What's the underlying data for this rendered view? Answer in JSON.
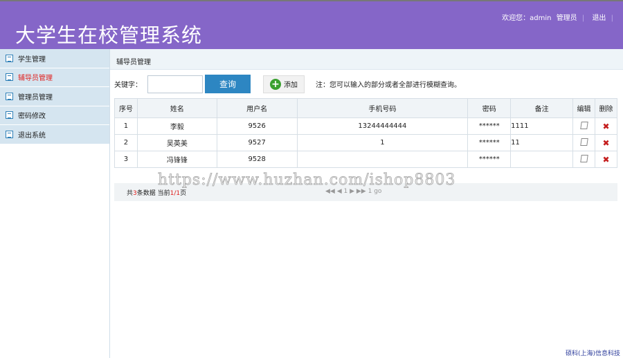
{
  "header": {
    "title": "大学生在校管理系统",
    "welcome": "欢迎您：admin",
    "role": "管理员",
    "logout": "退出"
  },
  "sidebar": {
    "items": [
      {
        "label": "学生管理"
      },
      {
        "label": "辅导员管理"
      },
      {
        "label": "管理员管理"
      },
      {
        "label": "密码修改"
      },
      {
        "label": "退出系统"
      }
    ]
  },
  "main": {
    "breadcrumb": "辅导员管理",
    "keyword_label": "关键字：",
    "keyword_value": "",
    "search_label": "查询",
    "add_label": "添加",
    "note": "注：您可以输入的部分或者全部进行模糊查询。",
    "columns": [
      "序号",
      "姓名",
      "用户名",
      "手机号码",
      "密码",
      "备注",
      "编辑",
      "删除"
    ],
    "rows": [
      {
        "no": "1",
        "name": "李毅",
        "username": "9526",
        "phone": "13244444444",
        "password": "******",
        "remark": "1111"
      },
      {
        "no": "2",
        "name": "吴英美",
        "username": "9527",
        "phone": "1",
        "password": "******",
        "remark": "11"
      },
      {
        "no": "3",
        "name": "冯锋锋",
        "username": "9528",
        "phone": "",
        "password": "******",
        "remark": ""
      }
    ],
    "pager": {
      "pre": "共",
      "count": "3",
      "mid": "条数据 当前",
      "page": "1/1",
      "post": "页",
      "nav": "◀◀ ◀ 1 ▶ ▶▶",
      "current": "1",
      "go": "go"
    }
  },
  "watermark": "https://www.huzhan.com/ishop8803",
  "footer": "硕科(上海)信息科技"
}
